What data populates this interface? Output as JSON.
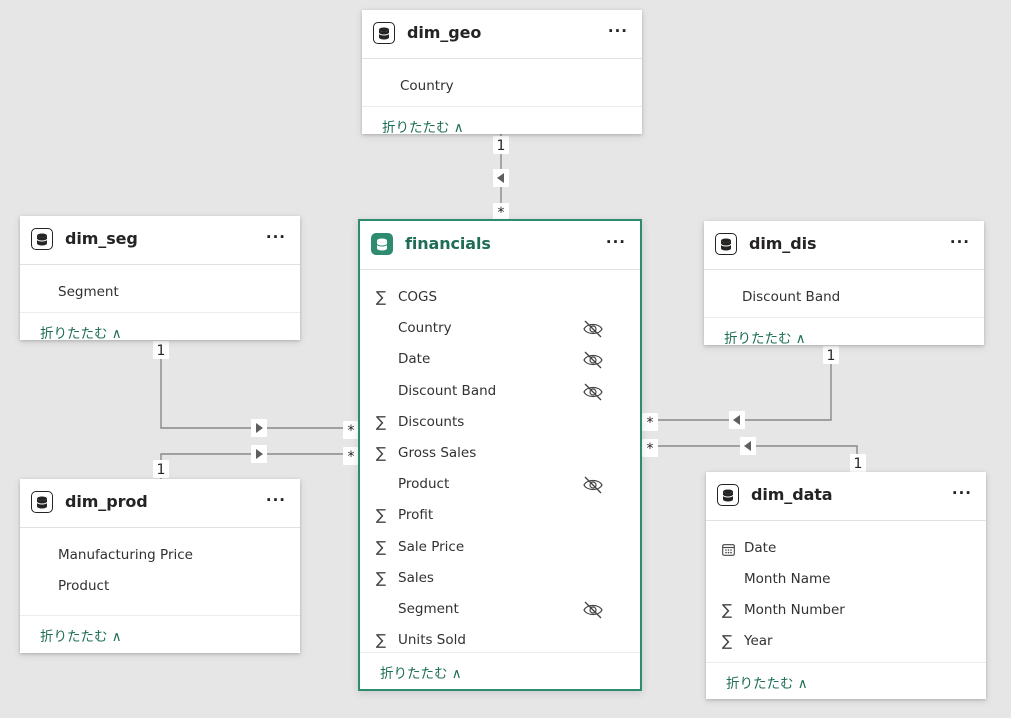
{
  "collapse_label": "折りたたむ ∧",
  "tables": {
    "dim_geo": {
      "title": "dim_geo",
      "fields": [
        {
          "label": "Country"
        }
      ]
    },
    "dim_seg": {
      "title": "dim_seg",
      "fields": [
        {
          "label": "Segment"
        }
      ]
    },
    "dim_dis": {
      "title": "dim_dis",
      "fields": [
        {
          "label": "Discount Band"
        }
      ]
    },
    "dim_prod": {
      "title": "dim_prod",
      "fields": [
        {
          "label": "Manufacturing Price"
        },
        {
          "label": "Product"
        }
      ]
    },
    "dim_data": {
      "title": "dim_data",
      "fields": [
        {
          "label": "Date",
          "icon": "calendar-icon"
        },
        {
          "label": "Month Name"
        },
        {
          "label": "Month Number",
          "icon": "sigma-icon"
        },
        {
          "label": "Year",
          "icon": "sigma-icon"
        }
      ]
    },
    "financials": {
      "title": "financials",
      "fields": [
        {
          "label": "COGS",
          "icon": "sigma-icon"
        },
        {
          "label": "Country",
          "hidden": true
        },
        {
          "label": "Date",
          "hidden": true
        },
        {
          "label": "Discount Band",
          "hidden": true
        },
        {
          "label": "Discounts",
          "icon": "sigma-icon"
        },
        {
          "label": "Gross Sales",
          "icon": "sigma-icon"
        },
        {
          "label": "Product",
          "hidden": true
        },
        {
          "label": "Profit",
          "icon": "sigma-icon"
        },
        {
          "label": "Sale Price",
          "icon": "sigma-icon"
        },
        {
          "label": "Sales",
          "icon": "sigma-icon"
        },
        {
          "label": "Segment",
          "hidden": true
        },
        {
          "label": "Units Sold",
          "icon": "sigma-icon"
        }
      ]
    }
  },
  "relationships": [
    {
      "from": "dim_geo",
      "to": "financials",
      "from_cardinality": "1",
      "to_cardinality": "*"
    },
    {
      "from": "dim_seg",
      "to": "financials",
      "from_cardinality": "1",
      "to_cardinality": "*"
    },
    {
      "from": "dim_prod",
      "to": "financials",
      "from_cardinality": "1",
      "to_cardinality": "*"
    },
    {
      "from": "dim_dis",
      "to": "financials",
      "from_cardinality": "1",
      "to_cardinality": "*"
    },
    {
      "from": "dim_data",
      "to": "financials",
      "from_cardinality": "1",
      "to_cardinality": "*"
    }
  ],
  "colors": {
    "accent": "#2e8b6f",
    "accent_text": "#1e6e57",
    "canvas": "#e6e6e6",
    "line": "#8a8886"
  }
}
